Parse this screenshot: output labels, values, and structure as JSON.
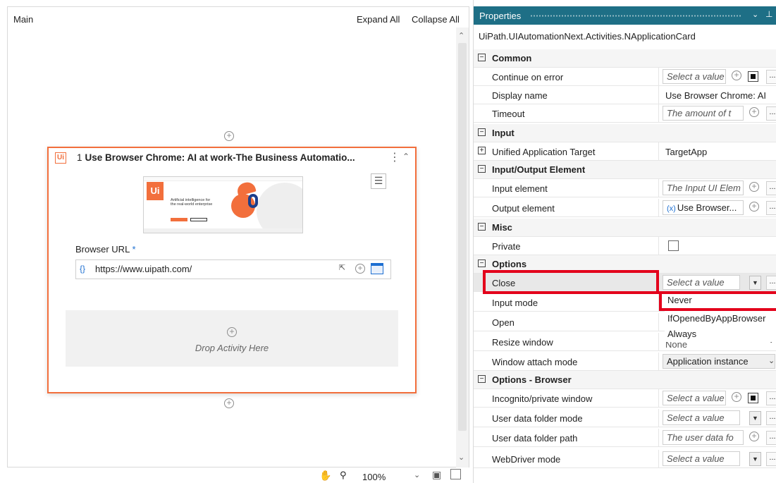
{
  "designer": {
    "title": "Main",
    "expand_all": "Expand All",
    "collapse_all": "Collapse All",
    "activity": {
      "index": "1",
      "title": "Use Browser Chrome: AI at work-The Business Automatio...",
      "logo_text": "Ui",
      "preview": {
        "logo_text": "Ui",
        "headline": "Artificial intelligence for the real-world enterprise"
      },
      "browser_url_label": "Browser URL",
      "required_marker": "*",
      "url_braces": "{}",
      "url_value": "https://www.uipath.com/",
      "drop_activity_text": "Drop Activity Here"
    },
    "zoom_level": "100%"
  },
  "properties": {
    "title": "Properties",
    "class_name": "UiPath.UIAutomationNext.Activities.NApplicationCard",
    "categories": {
      "common": "Common",
      "input": "Input",
      "input_output": "Input/Output Element",
      "misc": "Misc",
      "options": "Options",
      "options_browser": "Options - Browser"
    },
    "rows": {
      "continue_on_error": {
        "name": "Continue on error",
        "value": "Select a value"
      },
      "display_name": {
        "name": "Display name",
        "value": "Use Browser Chrome: AI"
      },
      "timeout": {
        "name": "Timeout",
        "value": "The amount of t"
      },
      "unified_target": {
        "name": "Unified Application Target",
        "value": "TargetApp"
      },
      "input_element": {
        "name": "Input element",
        "value": "The Input UI Elem"
      },
      "output_element": {
        "name": "Output element",
        "badge": "(x)",
        "value": "Use Browser..."
      },
      "private": {
        "name": "Private"
      },
      "close": {
        "name": "Close",
        "value": "Select a value"
      },
      "input_mode": {
        "name": "Input mode"
      },
      "open": {
        "name": "Open"
      },
      "resize_window": {
        "name": "Resize window",
        "value": "None"
      },
      "window_attach_mode": {
        "name": "Window attach mode",
        "value": "Application instance"
      },
      "incognito": {
        "name": "Incognito/private window",
        "value": "Select a value"
      },
      "user_data_folder_mode": {
        "name": "User data folder mode",
        "value": "Select a value"
      },
      "user_data_folder_path": {
        "name": "User data folder path",
        "value": "The user data fo"
      },
      "webdriver_mode": {
        "name": "WebDriver mode",
        "value": "Select a value"
      }
    },
    "close_dropdown_options": [
      "Never",
      "IfOpenedByAppBrowser",
      "Always"
    ]
  },
  "colors": {
    "accent_orange": "#f26f3c",
    "titlebar_teal": "#1e6f86",
    "highlight_red": "#e3001b",
    "link_blue": "#1d6fd1"
  },
  "icons": {
    "add": "add-circle-icon",
    "hand": "hand-pan-icon",
    "zoom": "zoom-icon",
    "fit": "fit-to-screen-icon",
    "overview": "overview-icon",
    "kebab": "more-vertical-icon",
    "collapse": "chevron-double-up-icon",
    "hamburger": "hamburger-menu-icon",
    "pin": "pin-icon"
  }
}
